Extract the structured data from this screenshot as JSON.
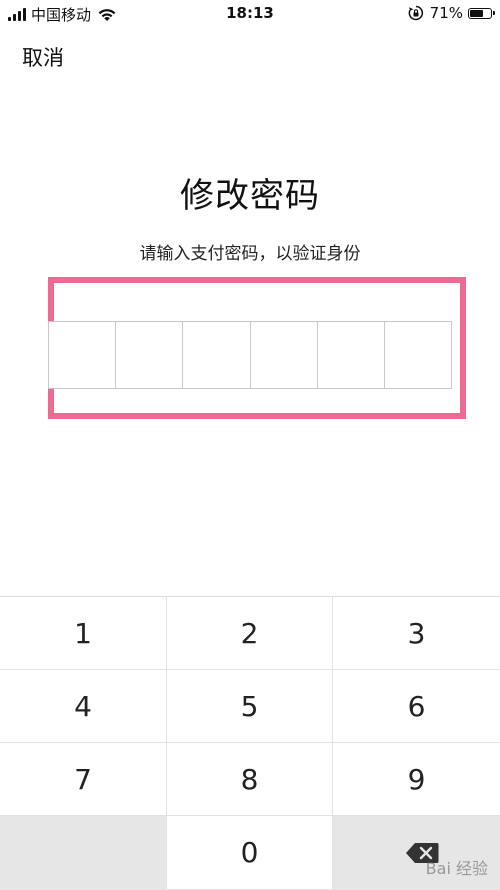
{
  "status_bar": {
    "carrier": "中国移动",
    "time": "18:13",
    "battery_percent": "71%",
    "battery_level": 0.71,
    "icons": [
      "signal-icon",
      "wifi-icon",
      "rotation-lock-icon",
      "battery-icon"
    ]
  },
  "nav": {
    "cancel_label": "取消"
  },
  "page": {
    "title": "修改密码",
    "subtitle": "请输入支付密码，以验证身份"
  },
  "pin": {
    "length": 6,
    "entered": 0
  },
  "keypad": {
    "keys": [
      "1",
      "2",
      "3",
      "4",
      "5",
      "6",
      "7",
      "8",
      "9",
      "0"
    ],
    "delete_icon": "backspace-icon"
  },
  "watermark": "Bai 经验",
  "colors": {
    "highlight": "#ee6a92",
    "keypad_gray": "#e6e6e6"
  }
}
